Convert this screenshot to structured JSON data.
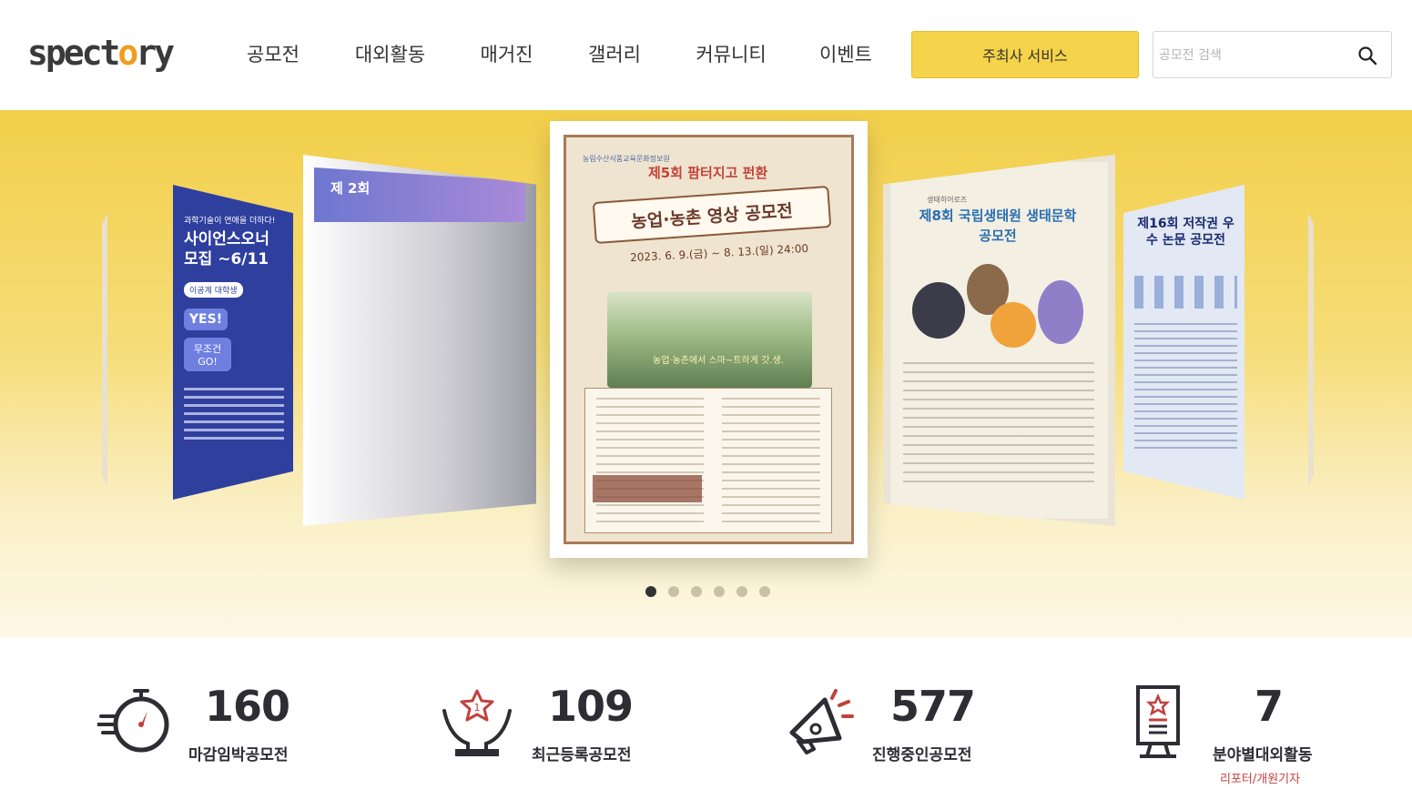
{
  "header": {
    "logo": {
      "pre": "spect",
      "accent": "o",
      "post": "ry"
    },
    "nav": [
      "공모전",
      "대외활동",
      "매거진",
      "갤러리",
      "커뮤니티",
      "이벤트"
    ],
    "host_button": "주최사 서비스",
    "search": {
      "placeholder": "공모전 검색",
      "value": ""
    }
  },
  "carousel": {
    "active_index": 0,
    "dot_count": 6,
    "cards": {
      "science": {
        "title_top": "과학기술이 연애을 더하다!",
        "title": "사이언스오너 모집 ~6/11",
        "pill": "이공계 대학생",
        "yes": "YES!",
        "go": "무조건 GO!"
      },
      "second": {
        "title": "제 2회"
      },
      "farm": {
        "org": "농림수산식품교육문화정보원",
        "title": "제5회 팜터지고 펀환",
        "headline": "농업·농촌 영상 공모전",
        "date": "2023. 6. 9.(금) ~ 8. 13.(일) 24:00",
        "scene_text": "농업·농촌에서 스마~트하게 갓.생."
      },
      "eco": {
        "sub": "생태히어로즈",
        "title": "제8회 국립생태원 생태문학 공모전"
      },
      "copyright": {
        "title": "제16회 저작권 우수 논문 공모전"
      }
    }
  },
  "stats": [
    {
      "count": "160",
      "label": "마감임박공모전",
      "icon": "stopwatch-icon"
    },
    {
      "count": "109",
      "label": "최근등록공모전",
      "icon": "award-hands-icon"
    },
    {
      "count": "577",
      "label": "진행중인공모전",
      "icon": "megaphone-icon"
    },
    {
      "count": "7",
      "label": "분야별대외활동",
      "sub": "리포터/개원기자",
      "icon": "banner-stand-icon"
    }
  ],
  "colors": {
    "accent": "#f5d34a",
    "text": "#2d2d33",
    "stat_accent": "#c1413d",
    "logo_accent": "#f29c1f"
  }
}
